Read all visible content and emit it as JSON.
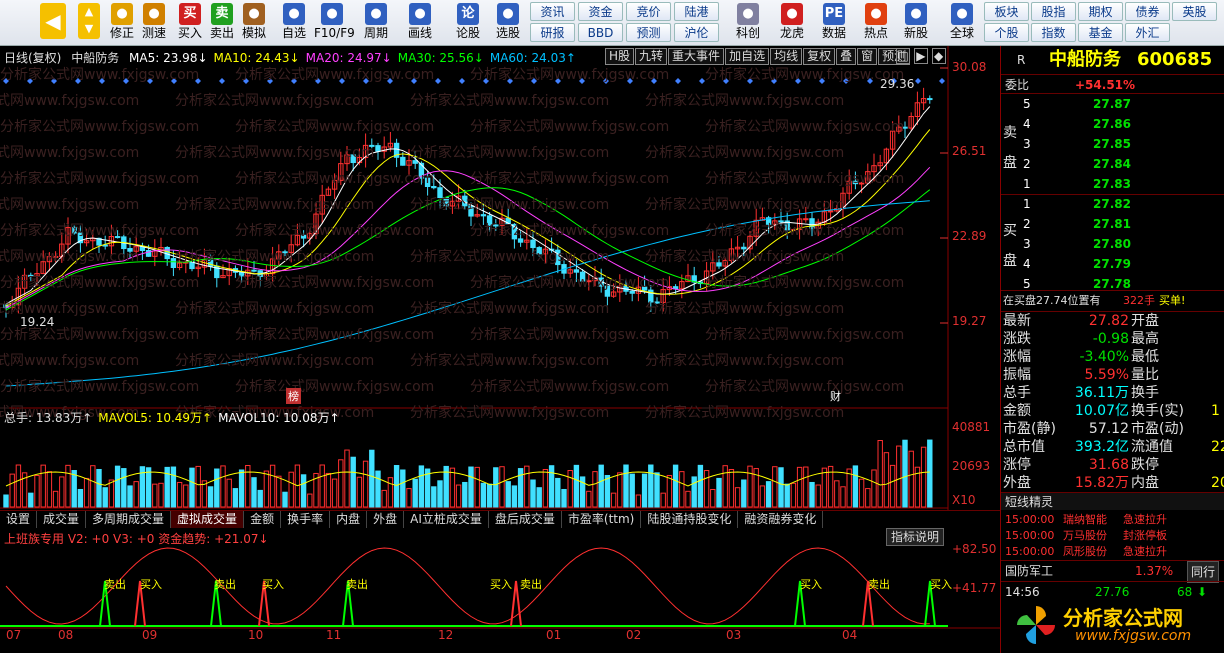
{
  "toolbar": {
    "buttons": [
      {
        "label": "修正",
        "icon": "history-icon",
        "color": "#e0a000"
      },
      {
        "label": "测速",
        "icon": "clock-icon",
        "color": "#d08000"
      },
      {
        "label": "买入",
        "icon": "buy-icon",
        "color": "#d02020",
        "glyph": "买"
      },
      {
        "label": "卖出",
        "icon": "sell-icon",
        "color": "#20a020",
        "glyph": "卖"
      },
      {
        "label": "模拟",
        "icon": "hammer-icon",
        "color": "#a06020"
      },
      {
        "label": "自选",
        "icon": "star-icon",
        "color": "#3060c0"
      },
      {
        "label": "F10/F9",
        "icon": "f10-icon",
        "color": "#3060c0"
      },
      {
        "label": "周期",
        "icon": "cycle-icon",
        "color": "#3060c0"
      },
      {
        "label": "画线",
        "icon": "pencil-icon",
        "color": "#3060c0"
      },
      {
        "label": "论股",
        "icon": "discuss-icon",
        "color": "#3060c0",
        "glyph": "论"
      },
      {
        "label": "选股",
        "icon": "select-icon",
        "color": "#3060c0"
      },
      {
        "label": "科创",
        "icon": "star-board-icon",
        "color": "#8080a0"
      },
      {
        "label": "龙虎",
        "icon": "dragon-icon",
        "color": "#d02020"
      },
      {
        "label": "数据",
        "icon": "pe-icon",
        "color": "#3060c0",
        "glyph": "PE"
      },
      {
        "label": "热点",
        "icon": "fire-icon",
        "color": "#e04010"
      },
      {
        "label": "新股",
        "icon": "new-stock-icon",
        "color": "#3060c0"
      },
      {
        "label": "全球",
        "icon": "globe-icon",
        "color": "#3060c0"
      }
    ],
    "grid": [
      [
        "资讯",
        "资金",
        "竞价",
        "陆港"
      ],
      [
        "研报",
        "BBD",
        "预测",
        "沪伦"
      ]
    ],
    "grid2": [
      [
        "板块",
        "股指",
        "期权",
        "债券",
        "英股"
      ],
      [
        "个股",
        "指数",
        "基金",
        "外汇"
      ]
    ]
  },
  "chart": {
    "header": "日线(复权)",
    "stock": "中船防务",
    "ma": [
      {
        "t": "MA5: 23.98↓",
        "c": "#ffffff"
      },
      {
        "t": "MA10: 24.43↓",
        "c": "#ffff00"
      },
      {
        "t": "MA20: 24.97↓",
        "c": "#ff40ff"
      },
      {
        "t": "MA30: 25.56↓",
        "c": "#00ff00"
      },
      {
        "t": "MA60: 24.03↑",
        "c": "#00c0ff"
      }
    ],
    "buttons": [
      "H股",
      "九转",
      "重大事件",
      "加自选",
      "均线",
      "复权",
      "叠",
      "窗",
      "预测"
    ],
    "axis": [
      "30.08",
      "26.51",
      "22.89",
      "19.27"
    ],
    "hi_label": "29.36",
    "lo_label": "19.24",
    "markers": [
      "榜",
      "财"
    ],
    "vol_header": [
      {
        "t": "总手: 13.83万↑",
        "c": "#e0e0e0"
      },
      {
        "t": "MAVOL5: 10.49万↑",
        "c": "#ffff00"
      },
      {
        "t": "MAVOL10: 10.08万↑",
        "c": "#ffffff"
      }
    ],
    "vol_axis": [
      "40881",
      "20693",
      "X10"
    ],
    "tabs": [
      "设置",
      "成交量",
      "多周期成交量",
      "虚拟成交量",
      "金额",
      "换手率",
      "内盘",
      "外盘",
      "AI立桩成交量",
      "盘后成交量",
      "市盈率(ttm)",
      "陆股通持股变化",
      "融资融券变化"
    ],
    "ind_header": "上班族专用  V2: +0  V3: +0  资金趋势: +21.07↓",
    "ind_button": "指标说明",
    "ind_axis": [
      "+82.50",
      "+41.77"
    ],
    "signals": [
      "卖出",
      "买入",
      "卖出",
      "买入",
      "卖出",
      "买入",
      "卖出",
      "买入",
      "卖出",
      "买入"
    ],
    "months": [
      "07",
      "08",
      "09",
      "10",
      "11",
      "12",
      "01",
      "02",
      "03",
      "04"
    ],
    "watermark": "分析家公式网www.fxjgsw.com"
  },
  "quote": {
    "code_prefix": "R",
    "name": "中船防务",
    "code": "600685",
    "weibi_label": "委比",
    "weibi": "+54.51%",
    "sell_label": [
      "卖",
      "盘"
    ],
    "buy_label": [
      "买",
      "盘"
    ],
    "asks": [
      [
        "5",
        "27.87"
      ],
      [
        "4",
        "27.86"
      ],
      [
        "3",
        "27.85"
      ],
      [
        "2",
        "27.84"
      ],
      [
        "1",
        "27.83"
      ]
    ],
    "bids": [
      [
        "1",
        "27.82"
      ],
      [
        "2",
        "27.81"
      ],
      [
        "3",
        "27.80"
      ],
      [
        "4",
        "27.79"
      ],
      [
        "5",
        "27.78"
      ]
    ],
    "notice": "在买盘27.74位置有",
    "notice_qty": "322手",
    "notice_tail": "买单!",
    "stats": [
      [
        "最新",
        "27.82",
        "开盘",
        ""
      ],
      [
        "涨跌",
        "-0.98",
        "最高",
        ""
      ],
      [
        "涨幅",
        "-3.40%",
        "最低",
        ""
      ],
      [
        "振幅",
        "5.59%",
        "量比",
        ""
      ],
      [
        "总手",
        "36.11万",
        "换手",
        ""
      ],
      [
        "金额",
        "10.07亿",
        "换手(实)",
        "1"
      ],
      [
        "市盈(静)",
        "57.12",
        "市盈(动)",
        ""
      ],
      [
        "总市值",
        "393.2亿",
        "流通值",
        "22"
      ],
      [
        "涨停",
        "31.68",
        "跌停",
        ""
      ],
      [
        "外盘",
        "15.82万",
        "内盘",
        "20"
      ]
    ],
    "elf_title": "短线精灵",
    "elf": [
      [
        "15:00:00",
        "瑞纳智能",
        "急速拉升"
      ],
      [
        "15:00:00",
        "万马股份",
        "封涨停板"
      ],
      [
        "15:00:00",
        "凤形股份",
        "急速拉升"
      ]
    ],
    "sector": "国防军工",
    "sector_pct": "1.37%",
    "sector_btn": "同行",
    "tick_time": "14:56",
    "tick_price": "27.76",
    "tick_vol": "68",
    "logo_text": "分析家公式网",
    "logo_url": "www.fxjgsw.com"
  }
}
